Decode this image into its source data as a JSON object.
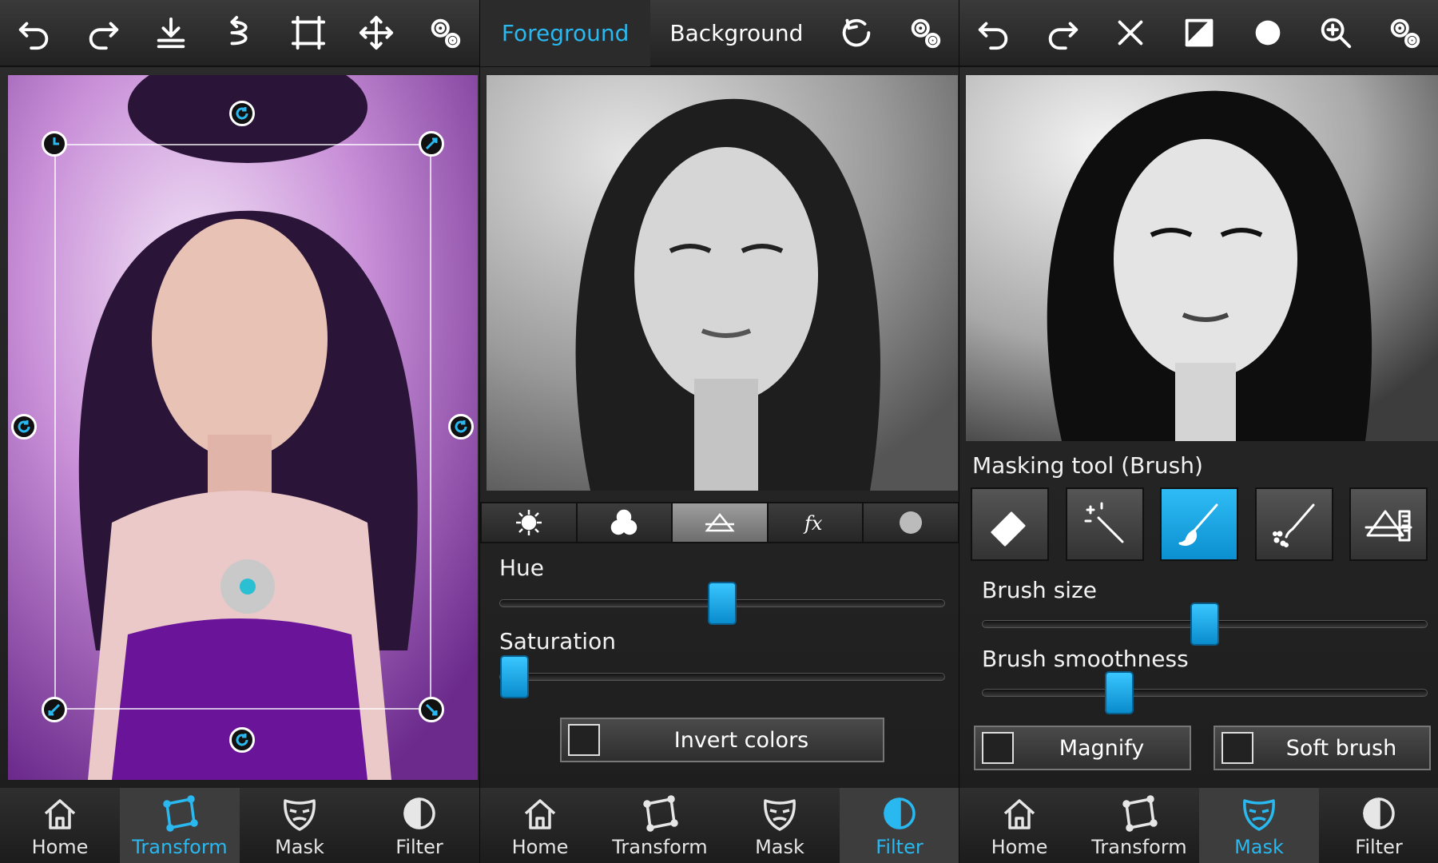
{
  "accent_color": "#29b8ef",
  "panel1": {
    "toolbar": [
      "undo-icon",
      "redo-icon",
      "download-icon",
      "flip-icon",
      "crop-icon",
      "move-icon",
      "settings-icon"
    ],
    "nav": [
      {
        "label": "Home",
        "icon": "home-icon",
        "active": false
      },
      {
        "label": "Transform",
        "icon": "transform-icon",
        "active": true
      },
      {
        "label": "Mask",
        "icon": "mask-icon",
        "active": false
      },
      {
        "label": "Filter",
        "icon": "filter-icon",
        "active": false
      }
    ]
  },
  "panel2": {
    "tabs": {
      "foreground": "Foreground",
      "background": "Background"
    },
    "toolbar": [
      "reset-icon",
      "settings-icon"
    ],
    "filter_tabs": [
      "brightness-icon",
      "color-icon",
      "levels-icon",
      "fx-icon",
      "vignette-icon"
    ],
    "hue_label": "Hue",
    "hue_value": 0.5,
    "saturation_label": "Saturation",
    "saturation_value": 0.0,
    "invert_label": "Invert colors",
    "invert_checked": false,
    "nav": [
      {
        "label": "Home",
        "icon": "home-icon",
        "active": false
      },
      {
        "label": "Transform",
        "icon": "transform-icon",
        "active": false
      },
      {
        "label": "Mask",
        "icon": "mask-icon",
        "active": false
      },
      {
        "label": "Filter",
        "icon": "filter-icon",
        "active": true
      }
    ]
  },
  "panel3": {
    "toolbar": [
      "undo-icon",
      "redo-icon",
      "clear-icon",
      "invert-mask-icon",
      "brush-preview-icon",
      "zoom-icon",
      "settings-icon"
    ],
    "masking_title": "Masking tool (Brush)",
    "tools": [
      "eraser-icon",
      "magic-wand-icon",
      "brush-icon",
      "spray-brush-icon",
      "gradient-icon"
    ],
    "active_tool": 2,
    "brush_size_label": "Brush size",
    "brush_size_value": 0.5,
    "brush_smoothness_label": "Brush smoothness",
    "brush_smoothness_value": 0.32,
    "magnify_label": "Magnify",
    "soft_brush_label": "Soft brush",
    "nav": [
      {
        "label": "Home",
        "icon": "home-icon",
        "active": false
      },
      {
        "label": "Transform",
        "icon": "transform-icon",
        "active": false
      },
      {
        "label": "Mask",
        "icon": "mask-icon",
        "active": true
      },
      {
        "label": "Filter",
        "icon": "filter-icon",
        "active": false
      }
    ]
  }
}
